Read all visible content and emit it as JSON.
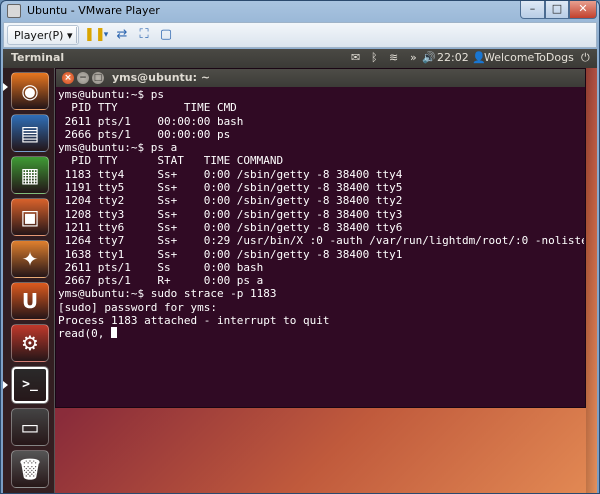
{
  "window": {
    "title": "Ubuntu - VMware Player",
    "min_symbol": "–",
    "max_symbol": "□",
    "close_symbol": "✕"
  },
  "toolbar": {
    "player_menu": "Player(P) ▾"
  },
  "topbar": {
    "app_name": "Terminal",
    "clock": "22:02",
    "user": "WelcomeToDogs"
  },
  "terminal": {
    "title": "yms@ubuntu: ~",
    "lines": [
      "yms@ubuntu:~$ ps",
      "  PID TTY          TIME CMD",
      " 2611 pts/1    00:00:00 bash",
      " 2666 pts/1    00:00:00 ps",
      "yms@ubuntu:~$ ps a",
      "  PID TTY      STAT   TIME COMMAND",
      " 1183 tty4     Ss+    0:00 /sbin/getty -8 38400 tty4",
      " 1191 tty5     Ss+    0:00 /sbin/getty -8 38400 tty5",
      " 1204 tty2     Ss+    0:00 /sbin/getty -8 38400 tty2",
      " 1208 tty3     Ss+    0:00 /sbin/getty -8 38400 tty3",
      " 1211 tty6     Ss+    0:00 /sbin/getty -8 38400 tty6",
      " 1264 tty7     Ss+    0:29 /usr/bin/X :0 -auth /var/run/lightdm/root/:0 -noliste",
      " 1638 tty1     Ss+    0:00 /sbin/getty -8 38400 tty1",
      " 2611 pts/1    Ss     0:00 bash",
      " 2667 pts/1    R+     0:00 ps a",
      "yms@ubuntu:~$ sudo strace -p 1183",
      "[sudo] password for yms:",
      "Process 1183 attached - interrupt to quit"
    ],
    "last_line": "read(0, "
  },
  "launcher": {
    "items": [
      {
        "name": "firefox-icon",
        "glyph": "◉",
        "color": "#e8761f"
      },
      {
        "name": "libreoffice-writer-icon",
        "glyph": "▤",
        "color": "#2f6fb8"
      },
      {
        "name": "libreoffice-calc-icon",
        "glyph": "▦",
        "color": "#3f9c35"
      },
      {
        "name": "libreoffice-impress-icon",
        "glyph": "▣",
        "color": "#d9622b"
      },
      {
        "name": "software-center-icon",
        "glyph": "✦",
        "color": "#e0802e"
      },
      {
        "name": "ubuntu-one-icon",
        "glyph": "U",
        "color": "#dd5a1e"
      },
      {
        "name": "system-settings-icon",
        "glyph": "⚙",
        "color": "#c0392b"
      },
      {
        "name": "terminal-icon",
        "glyph": ">_",
        "color": "#2b2b2b"
      },
      {
        "name": "workspace-switcher-icon",
        "glyph": "▭",
        "color": "#444444"
      },
      {
        "name": "trash-icon",
        "glyph": "🗑",
        "color": "#555555"
      }
    ]
  }
}
